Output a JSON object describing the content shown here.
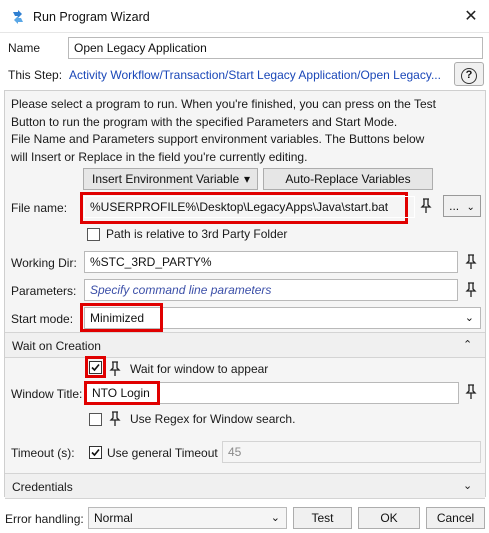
{
  "window": {
    "title": "Run Program Wizard"
  },
  "header": {
    "name_label": "Name",
    "name_value": "Open Legacy Application",
    "this_step_label": "This Step:",
    "this_step_link": "Activity Workflow/Transaction/Start Legacy Application/Open Legacy...",
    "help_label": "?"
  },
  "instructions": "Please select a program to run. When you're finished, you can press on the Test Button to run the program with the specified Parameters and Start Mode. File Name and Parameters support environment variables. The Buttons below will Insert or Replace in the field you're currently editing.",
  "instruction_lines": [
    "Please select a program to run. When you're finished, you can press on the Test",
    "Button to run the program with the specified Parameters and Start Mode.",
    "File Name and Parameters support environment variables. The Buttons below",
    "will Insert or Replace in the field you're currently editing."
  ],
  "toolbar": {
    "insert_env_label": "Insert Environment Variable",
    "auto_replace_label": "Auto-Replace Variables"
  },
  "form": {
    "file_name_label": "File name:",
    "file_name_value": "%USERPROFILE%\\Desktop\\LegacyApps\\Java\\start.bat",
    "browse_label": "...",
    "path_relative_label": "Path is relative to 3rd Party Folder",
    "working_dir_label": "Working Dir:",
    "working_dir_value": "%STC_3RD_PARTY%",
    "parameters_label": "Parameters:",
    "parameters_placeholder": "Specify command line parameters",
    "start_mode_label": "Start mode:",
    "start_mode_value": "Minimized"
  },
  "wait_section": {
    "title": "Wait on Creation",
    "wait_for_window_label": "Wait for window to appear",
    "wait_for_window_checked": true,
    "window_title_label": "Window Title:",
    "window_title_value": "NTO Login",
    "use_regex_label": "Use Regex for Window search.",
    "use_regex_checked": false,
    "timeout_label": "Timeout (s):",
    "use_general_timeout_label": "Use general Timeout",
    "use_general_timeout_checked": true,
    "timeout_value": "45"
  },
  "credentials_section": {
    "title": "Credentials"
  },
  "footer": {
    "error_handling_label": "Error handling:",
    "error_handling_value": "Normal",
    "test_label": "Test",
    "ok_label": "OK",
    "cancel_label": "Cancel"
  },
  "colors": {
    "link": "#1a47b8",
    "highlight": "#e00000",
    "accent_icon": "#2f7fd1"
  },
  "icons": [
    "app-icon",
    "close-icon",
    "pin-icon",
    "chevron-down-icon",
    "chevron-up-icon",
    "check-icon"
  ]
}
